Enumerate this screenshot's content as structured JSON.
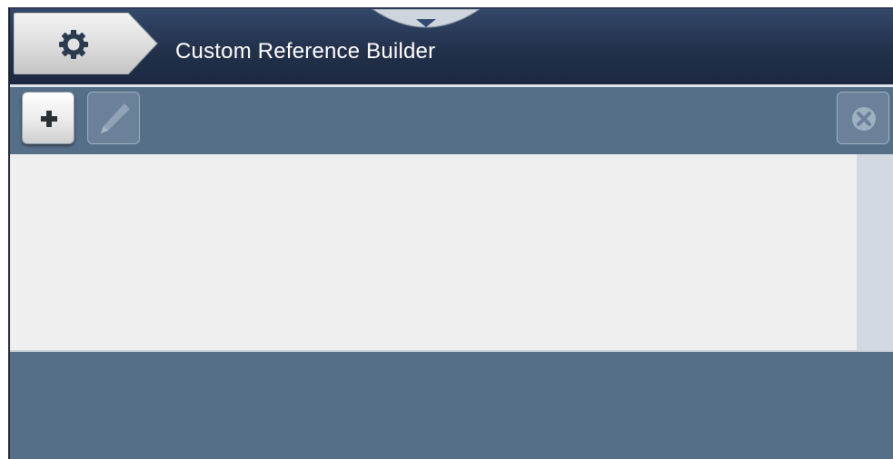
{
  "header": {
    "title": "Custom Reference Builder",
    "settings_icon": "gear-icon",
    "pulldown_icon": "chevron-down-icon"
  },
  "toolbar": {
    "add_icon": "plus-icon",
    "edit_icon": "pencil-icon",
    "close_icon": "close-icon"
  },
  "list": {
    "items": []
  },
  "colors": {
    "header_bg": "#22304a",
    "toolbar_bg": "#566f88",
    "list_bg": "#efefef",
    "scrollbar_bg": "#d3d9e0"
  }
}
